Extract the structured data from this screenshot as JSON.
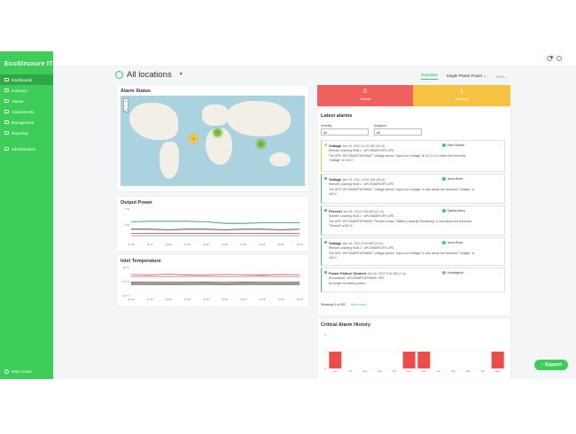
{
  "sidebar": {
    "logo": "EcoStruxure IT",
    "items": [
      {
        "label": "Dashboards",
        "icon": "dashboard-icon",
        "active": true
      },
      {
        "label": "Inventory",
        "icon": "inventory-icon"
      },
      {
        "label": "Alarms",
        "icon": "alarm-icon"
      },
      {
        "label": "Assessments",
        "icon": "assessment-icon"
      },
      {
        "label": "Management",
        "icon": "management-icon"
      },
      {
        "label": "Reporting",
        "icon": "reporting-icon"
      },
      {
        "label": "Administration",
        "icon": "settings-icon"
      }
    ],
    "help": "Help Center"
  },
  "header": {
    "title": "All locations",
    "tabs": [
      "Overview",
      "Single Phase Power ⌄",
      "More..."
    ]
  },
  "alarm_status": {
    "title": "Alarm Status",
    "clusters": [
      {
        "label": "1",
        "color": "#f5c242"
      },
      {
        "label": "7",
        "color": "#7fc241"
      },
      {
        "label": "6",
        "color": "#7fc241"
      }
    ]
  },
  "output_power": {
    "title": "Output Power",
    "y_ticks": [
      "5 W",
      "2 W",
      ""
    ],
    "x_ticks": [
      "11:30",
      "11:45",
      "12:00",
      "12:15",
      "12:30",
      "12:45",
      "13:00",
      "13:15",
      "13:30",
      "13:45"
    ]
  },
  "inlet_temperature": {
    "title": "Inlet Temperature",
    "y_ticks": [
      "30 °C",
      "25 °C",
      "20 °C"
    ],
    "x_ticks": [
      "11:30",
      "11:45",
      "12:00",
      "12:15",
      "12:30",
      "12:45",
      "13:00",
      "13:15",
      "13:30",
      "13:45"
    ]
  },
  "summary": {
    "critical": {
      "count": "0",
      "label": "Critical",
      "color": "#f0605e"
    },
    "warning": {
      "count": "1",
      "label": "Warning",
      "color": "#f5c242"
    }
  },
  "latest_alarms": {
    "title": "Latest alarms",
    "severity_label": "Severity",
    "severity_value": "All",
    "assignee_label": "Assignee",
    "assignee_value": "All",
    "items": [
      {
        "type": "Voltage",
        "time": "Jan 19, 2021 11:01 AM (18 m)",
        "assignee": "Eder Fischer",
        "line2": "Remote Learning HUB 1 › APCSMARTUPS UPS",
        "line3": "The UPS \"APCSMARTUPSNMC\" Voltage sensor \"Input Line Voltage\" at 117.5 V is below the threshold",
        "line4": "\"Voltage\" of 118 V.",
        "status": "warning"
      },
      {
        "type": "Voltage",
        "time": "Jan 19, 2021 10:01 AM (48 m)",
        "assignee": "Anna Rossi",
        "line2": "Remote Learning HUB 1 › APCSMARTUPS UPS",
        "line3": "The UPS \"APCSMARTUPSNMC\" Voltage sensor \"Input Line Voltage\" is now above the threshold \"Voltage\" of",
        "line4": "118 V.",
        "status": "ok"
      },
      {
        "type": "Percent",
        "time": "Jan 18, 2021 9:46 AM (21 m)",
        "assignee": "Danita Abreu",
        "line2": "Remote Learning HUB 1 › APCSMARTUPS UPS",
        "line3": "The UPS \"APCSMARTUPSNMC\" Percent sensor \"Battery Capacity Remaining\" is now above the threshold",
        "line4": "\"Percent\" of 80 %.",
        "status": "ok"
      },
      {
        "type": "Voltage",
        "time": "Jan 18, 2021 9:40 AM (20 m)",
        "assignee": "Anna Rossi",
        "line2": "Remote Learning HUB 1 › APCSMARTUPS UPS",
        "line3": "The UPS \"APCSMARTUPSNMC\" Voltage sensor \"Input Line Voltage\" is now above the threshold \"Voltage\" of",
        "line4": "118 V.",
        "status": "ok"
      },
      {
        "type": "Power Failure Cleared",
        "time": "Jan 18, 2021 9:40 AM (1 m)",
        "assignee": "Unassigned",
        "line2": "All locations › APCSMARTUPSNMC UPS",
        "line3": "No longer on battery power.",
        "line4": "",
        "status": "ok"
      }
    ],
    "showing": "Showing 5 of 201",
    "view_more": "View more"
  },
  "critical_history": {
    "title": "Critical Alarm History",
    "y_ticks": [
      "2",
      "1",
      "0"
    ],
    "x_ticks": [
      "Jun",
      "Jul",
      "Aug",
      "Sep",
      "Oct",
      "Nov",
      "Dec",
      "Jan",
      "Feb",
      "Mar",
      "Apr",
      "May"
    ]
  },
  "support_button": "Support",
  "chart_data": [
    {
      "type": "bar",
      "title": "Critical Alarm History",
      "categories": [
        "Jun",
        "Jul",
        "Aug",
        "Sep",
        "Oct",
        "Nov",
        "Dec",
        "Jan",
        "Feb",
        "Mar",
        "Apr",
        "May"
      ],
      "values": [
        1,
        0,
        0,
        0,
        0,
        1,
        1,
        0,
        0,
        0,
        0,
        1
      ],
      "ylim": [
        0,
        2
      ],
      "color": "#ee4c49"
    },
    {
      "type": "line",
      "title": "Output Power",
      "x": [
        "11:30",
        "11:45",
        "12:00",
        "12:15",
        "12:30",
        "12:45",
        "13:00",
        "13:15",
        "13:30",
        "13:45"
      ],
      "series": [
        {
          "color": "#2e8b57",
          "values": [
            3.6,
            3.7,
            3.7,
            3.7,
            3.6,
            3.3,
            3.3,
            3.4,
            3.4,
            3.4
          ]
        },
        {
          "color": "#333333",
          "values": [
            2.2,
            2.2,
            2.1,
            2.2,
            2.2,
            2.1,
            2.2,
            2.2,
            2.1,
            2.2
          ]
        },
        {
          "color": "#c94040",
          "values": [
            1.4,
            1.4,
            1.4,
            1.4,
            1.4,
            1.4,
            1.4,
            1.4,
            1.4,
            1.4
          ]
        },
        {
          "color": "#9a7fbf",
          "values": [
            1.0,
            1.0,
            1.0,
            1.0,
            1.0,
            1.0,
            1.0,
            1.0,
            1.0,
            1.0
          ]
        }
      ],
      "ylim": [
        0,
        6
      ]
    },
    {
      "type": "line",
      "title": "Inlet Temperature",
      "x": [
        "11:30",
        "11:45",
        "12:00",
        "12:15",
        "12:30",
        "12:45",
        "13:00",
        "13:15",
        "13:30",
        "13:45"
      ],
      "series": [
        {
          "color": "#c94040",
          "values": [
            28.5,
            28.4,
            28.6,
            28.3,
            28.4,
            28.5,
            28.4,
            28.3,
            28.5,
            28.4
          ]
        },
        {
          "color": "#c77ab0",
          "values": [
            27.5,
            27.6,
            27.4,
            27.5,
            27.6,
            27.4,
            27.5,
            27.6,
            27.4,
            27.5
          ]
        },
        {
          "color": "#2e8b57",
          "values": [
            24.8,
            24.9,
            24.8,
            24.9,
            24.8,
            24.9,
            24.8,
            24.9,
            24.8,
            24.9
          ]
        },
        {
          "color": "#8b3a3a",
          "values": [
            24.2,
            24.2,
            24.1,
            24.2,
            24.2,
            24.1,
            24.2,
            24.2,
            24.1,
            24.2
          ]
        },
        {
          "color": "#555555",
          "values": [
            23.6,
            23.6,
            23.6,
            23.6,
            23.6,
            23.6,
            23.6,
            23.6,
            23.6,
            23.6
          ]
        }
      ],
      "ylim": [
        18,
        32
      ]
    }
  ]
}
